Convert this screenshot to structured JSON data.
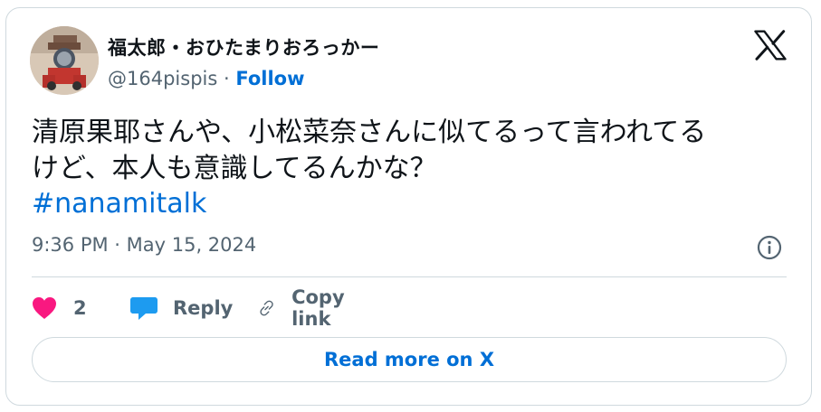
{
  "author": {
    "display_name": "福太郎・おひたまりおろっかー",
    "handle": "@164pispis",
    "separator": " · ",
    "follow_label": "Follow"
  },
  "tweet": {
    "text": "清原果耶さんや、小松菜奈さんに似てるって言われてる\nけど、本人も意識してるんかな？",
    "hashtag": "#nanamitalk",
    "timestamp": "9:36 PM · May 15, 2024"
  },
  "actions": {
    "like_count": "2",
    "reply_label": "Reply",
    "copy_link_label": "Copy link"
  },
  "read_more_label": "Read more on X",
  "colors": {
    "link": "#006fd6",
    "like": "#f91880",
    "reply_icon": "#1d9bf0",
    "secondary_text": "#536471",
    "border": "#cfd9de"
  },
  "icons": [
    "x-logo-icon",
    "info-icon",
    "heart-icon",
    "reply-bubble-icon",
    "link-icon"
  ]
}
